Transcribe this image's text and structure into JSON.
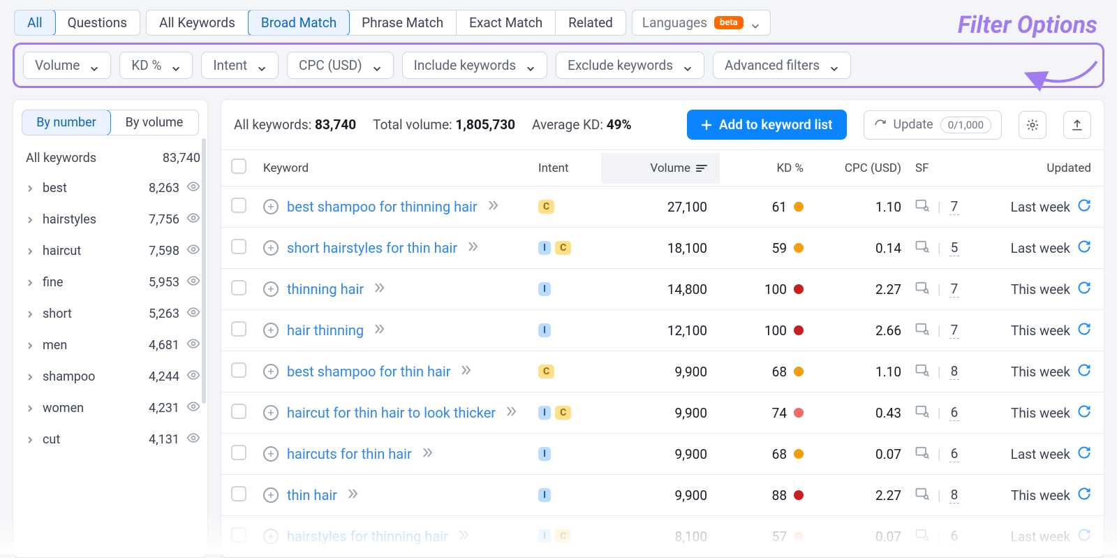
{
  "tabsA": [
    "All",
    "Questions"
  ],
  "tabsA_active": 0,
  "tabsB": [
    "All Keywords",
    "Broad Match",
    "Phrase Match",
    "Exact Match",
    "Related"
  ],
  "tabsB_active": 1,
  "languages_label": "Languages",
  "beta_label": "beta",
  "filters": [
    "Volume",
    "KD %",
    "Intent",
    "CPC (USD)",
    "Include keywords",
    "Exclude keywords",
    "Advanced filters"
  ],
  "filter_annotation": "Filter Options",
  "sidebar": {
    "mode": [
      "By number",
      "By volume"
    ],
    "mode_active": 0,
    "header_label": "All keywords",
    "header_count": "83,740",
    "groups": [
      {
        "label": "best",
        "count": "8,263"
      },
      {
        "label": "hairstyles",
        "count": "7,756"
      },
      {
        "label": "haircut",
        "count": "7,598"
      },
      {
        "label": "fine",
        "count": "5,953"
      },
      {
        "label": "short",
        "count": "5,263"
      },
      {
        "label": "men",
        "count": "4,681"
      },
      {
        "label": "shampoo",
        "count": "4,244"
      },
      {
        "label": "women",
        "count": "4,231"
      },
      {
        "label": "cut",
        "count": "4,131"
      }
    ]
  },
  "stats": {
    "all_keywords_label": "All keywords:",
    "all_keywords_value": "83,740",
    "total_volume_label": "Total volume:",
    "total_volume_value": "1,805,730",
    "avg_kd_label": "Average KD:",
    "avg_kd_value": "49%"
  },
  "actions": {
    "add_to_list": "Add to keyword list",
    "update": "Update",
    "update_counter": "0/1,000"
  },
  "columns": {
    "keyword": "Keyword",
    "intent": "Intent",
    "volume": "Volume",
    "kd": "KD %",
    "cpc": "CPC (USD)",
    "sf": "SF",
    "updated": "Updated"
  },
  "rows": [
    {
      "keyword": "best shampoo for thinning hair",
      "intent": [
        "C"
      ],
      "volume": "27,100",
      "kd": "61",
      "kd_color": "orange",
      "cpc": "1.10",
      "sf": "7",
      "updated": "Last week"
    },
    {
      "keyword": "short hairstyles for thin hair",
      "intent": [
        "I",
        "C"
      ],
      "volume": "18,100",
      "kd": "59",
      "kd_color": "orange",
      "cpc": "0.14",
      "sf": "5",
      "updated": "Last week"
    },
    {
      "keyword": "thinning hair",
      "intent": [
        "I"
      ],
      "volume": "14,800",
      "kd": "100",
      "kd_color": "red",
      "cpc": "2.27",
      "sf": "7",
      "updated": "This week"
    },
    {
      "keyword": "hair thinning",
      "intent": [
        "I"
      ],
      "volume": "12,100",
      "kd": "100",
      "kd_color": "red",
      "cpc": "2.66",
      "sf": "7",
      "updated": "This week"
    },
    {
      "keyword": "best shampoo for thin hair",
      "intent": [
        "C"
      ],
      "volume": "9,900",
      "kd": "68",
      "kd_color": "orange",
      "cpc": "1.10",
      "sf": "8",
      "updated": "This week"
    },
    {
      "keyword": "haircut for thin hair to look thicker",
      "intent": [
        "I",
        "C"
      ],
      "volume": "9,900",
      "kd": "74",
      "kd_color": "pink",
      "cpc": "0.43",
      "sf": "6",
      "updated": "This week"
    },
    {
      "keyword": "haircuts for thin hair",
      "intent": [
        "I"
      ],
      "volume": "9,900",
      "kd": "68",
      "kd_color": "orange",
      "cpc": "0.07",
      "sf": "6",
      "updated": "Last week"
    },
    {
      "keyword": "thin hair",
      "intent": [
        "I"
      ],
      "volume": "9,900",
      "kd": "88",
      "kd_color": "red",
      "cpc": "2.27",
      "sf": "8",
      "updated": "This week"
    },
    {
      "keyword": "hairstyles for thinning hair",
      "intent": [
        "I",
        "C"
      ],
      "volume": "8,100",
      "kd": "57",
      "kd_color": "salmon",
      "cpc": "0.07",
      "sf": "6",
      "updated": "Last week",
      "faded": true
    }
  ]
}
